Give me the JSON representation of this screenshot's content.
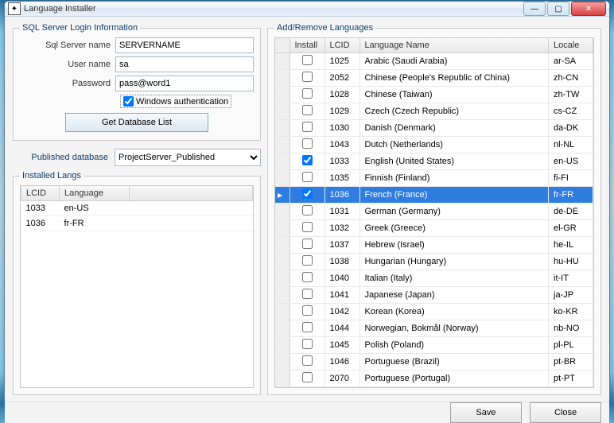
{
  "window": {
    "title": "Language Installer"
  },
  "login": {
    "legend": "SQL Server Login Information",
    "server_label": "Sql Server name",
    "server_value": "SERVERNAME",
    "user_label": "User name",
    "user_value": "sa",
    "password_label": "Password",
    "password_value": "pass@word1",
    "winauth_label": "Windows authentication",
    "winauth_checked": true,
    "getdb_label": "Get Database List"
  },
  "published": {
    "label": "Published database",
    "value": "ProjectServer_Published"
  },
  "installed": {
    "legend": "Installed Langs",
    "col_lcid": "LCID",
    "col_lang": "Language",
    "rows": [
      {
        "lcid": "1033",
        "lang": "en-US"
      },
      {
        "lcid": "1036",
        "lang": "fr-FR"
      }
    ]
  },
  "addremove": {
    "legend": "Add/Remove Languages",
    "col_install": "Install",
    "col_lcid": "LCID",
    "col_name": "Language Name",
    "col_locale": "Locale",
    "selected_lcid": "1036",
    "rows": [
      {
        "install": false,
        "lcid": "1025",
        "name": "Arabic (Saudi Arabia)",
        "locale": "ar-SA"
      },
      {
        "install": false,
        "lcid": "2052",
        "name": "Chinese (People's Republic of China)",
        "locale": "zh-CN"
      },
      {
        "install": false,
        "lcid": "1028",
        "name": "Chinese (Taiwan)",
        "locale": "zh-TW"
      },
      {
        "install": false,
        "lcid": "1029",
        "name": "Czech (Czech Republic)",
        "locale": "cs-CZ"
      },
      {
        "install": false,
        "lcid": "1030",
        "name": "Danish (Denmark)",
        "locale": "da-DK"
      },
      {
        "install": false,
        "lcid": "1043",
        "name": "Dutch (Netherlands)",
        "locale": "nl-NL"
      },
      {
        "install": true,
        "lcid": "1033",
        "name": "English (United States)",
        "locale": "en-US"
      },
      {
        "install": false,
        "lcid": "1035",
        "name": "Finnish (Finland)",
        "locale": "fi-FI"
      },
      {
        "install": true,
        "lcid": "1036",
        "name": "French (France)",
        "locale": "fr-FR"
      },
      {
        "install": false,
        "lcid": "1031",
        "name": "German (Germany)",
        "locale": "de-DE"
      },
      {
        "install": false,
        "lcid": "1032",
        "name": "Greek (Greece)",
        "locale": "el-GR"
      },
      {
        "install": false,
        "lcid": "1037",
        "name": "Hebrew (Israel)",
        "locale": "he-IL"
      },
      {
        "install": false,
        "lcid": "1038",
        "name": "Hungarian (Hungary)",
        "locale": "hu-HU"
      },
      {
        "install": false,
        "lcid": "1040",
        "name": "Italian (Italy)",
        "locale": "it-IT"
      },
      {
        "install": false,
        "lcid": "1041",
        "name": "Japanese (Japan)",
        "locale": "ja-JP"
      },
      {
        "install": false,
        "lcid": "1042",
        "name": "Korean (Korea)",
        "locale": "ko-KR"
      },
      {
        "install": false,
        "lcid": "1044",
        "name": "Norwegian, Bokmål (Norway)",
        "locale": "nb-NO"
      },
      {
        "install": false,
        "lcid": "1045",
        "name": "Polish (Poland)",
        "locale": "pl-PL"
      },
      {
        "install": false,
        "lcid": "1046",
        "name": "Portuguese (Brazil)",
        "locale": "pt-BR"
      },
      {
        "install": false,
        "lcid": "2070",
        "name": "Portuguese (Portugal)",
        "locale": "pt-PT"
      }
    ]
  },
  "footer": {
    "save": "Save",
    "close": "Close"
  }
}
